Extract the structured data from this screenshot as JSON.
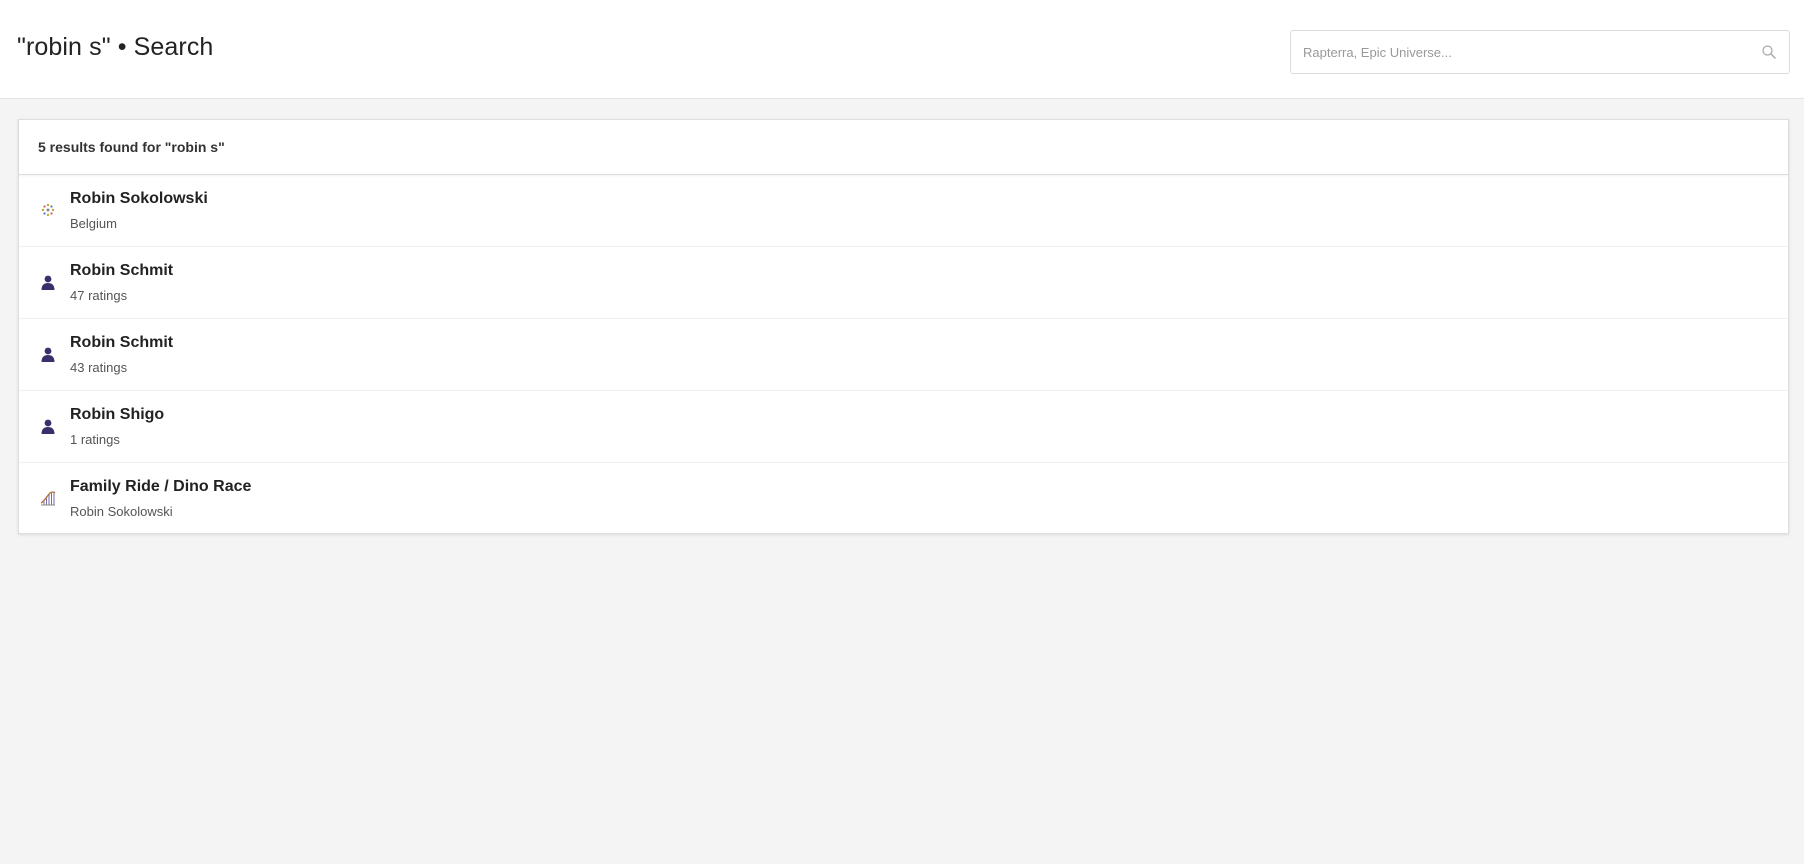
{
  "header": {
    "title": "\"robin s\" • Search"
  },
  "search": {
    "placeholder": "Rapterra, Epic Universe...",
    "value": "",
    "icon": "search-icon"
  },
  "results": {
    "summary": "5 results found for \"robin s\"",
    "items": [
      {
        "title": "Robin Sokolowski",
        "subtitle": "Belgium",
        "icon": "flag-icon"
      },
      {
        "title": "Robin Schmit",
        "subtitle": "47 ratings",
        "icon": "user-icon"
      },
      {
        "title": "Robin Schmit",
        "subtitle": "43 ratings",
        "icon": "user-icon"
      },
      {
        "title": "Robin Shigo",
        "subtitle": "1 ratings",
        "icon": "user-icon"
      },
      {
        "title": "Family Ride / Dino Race",
        "subtitle": "Robin Sokolowski",
        "icon": "coaster-icon"
      }
    ]
  },
  "colors": {
    "background": "#f4f4f4",
    "card": "#ffffff",
    "user_icon": "#3a2f6b"
  }
}
